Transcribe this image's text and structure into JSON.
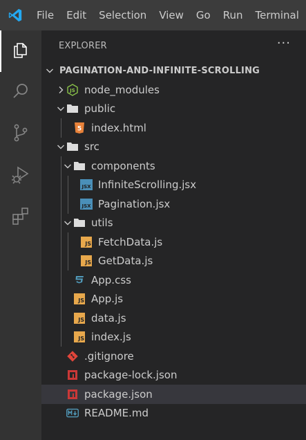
{
  "menubar": {
    "items": [
      "File",
      "Edit",
      "Selection",
      "View",
      "Go",
      "Run",
      "Terminal"
    ]
  },
  "activitybar": {
    "items": [
      {
        "name": "explorer-icon",
        "active": true
      },
      {
        "name": "search-icon",
        "active": false
      },
      {
        "name": "source-control-icon",
        "active": false
      },
      {
        "name": "run-debug-icon",
        "active": false
      },
      {
        "name": "extensions-icon",
        "active": false
      }
    ]
  },
  "sidebar": {
    "title": "EXPLORER",
    "more": "···",
    "root": "PAGINATION-AND-INFINITE-SCROLLING",
    "tree": [
      {
        "label": "node_modules",
        "type": "folder-node",
        "depth": 0,
        "expanded": false
      },
      {
        "label": "public",
        "type": "folder",
        "depth": 0,
        "expanded": true
      },
      {
        "label": "index.html",
        "type": "html",
        "depth": 1
      },
      {
        "label": "src",
        "type": "folder",
        "depth": 0,
        "expanded": true
      },
      {
        "label": "components",
        "type": "folder",
        "depth": 1,
        "expanded": true
      },
      {
        "label": "InfiniteScrolling.jsx",
        "type": "jsx",
        "depth": 2
      },
      {
        "label": "Pagination.jsx",
        "type": "jsx",
        "depth": 2
      },
      {
        "label": "utils",
        "type": "folder",
        "depth": 1,
        "expanded": true
      },
      {
        "label": "FetchData.js",
        "type": "js",
        "depth": 2
      },
      {
        "label": "GetData.js",
        "type": "js",
        "depth": 2
      },
      {
        "label": "App.css",
        "type": "css",
        "depth": 1
      },
      {
        "label": "App.js",
        "type": "js",
        "depth": 1
      },
      {
        "label": "data.js",
        "type": "js",
        "depth": 1
      },
      {
        "label": "index.js",
        "type": "js",
        "depth": 1
      },
      {
        "label": ".gitignore",
        "type": "git",
        "depth": 0
      },
      {
        "label": "package-lock.json",
        "type": "npm",
        "depth": 0
      },
      {
        "label": "package.json",
        "type": "npm",
        "depth": 0,
        "selected": true
      },
      {
        "label": "README.md",
        "type": "md",
        "depth": 0
      }
    ]
  },
  "colors": {
    "menubar_bg": "#3c3c3c",
    "activitybar_bg": "#333333",
    "sidebar_bg": "#252526",
    "selected_bg": "#37373d",
    "js_badge": "#e8a84c",
    "jsx_badge": "#4a8fb8",
    "html_icon": "#e8823a",
    "css_icon": "#519aba",
    "git_icon": "#e0453a",
    "npm_icon": "#cb3837",
    "md_icon": "#519aba",
    "node_icon": "#8bc34a",
    "vscode_blue": "#23a9f2"
  }
}
